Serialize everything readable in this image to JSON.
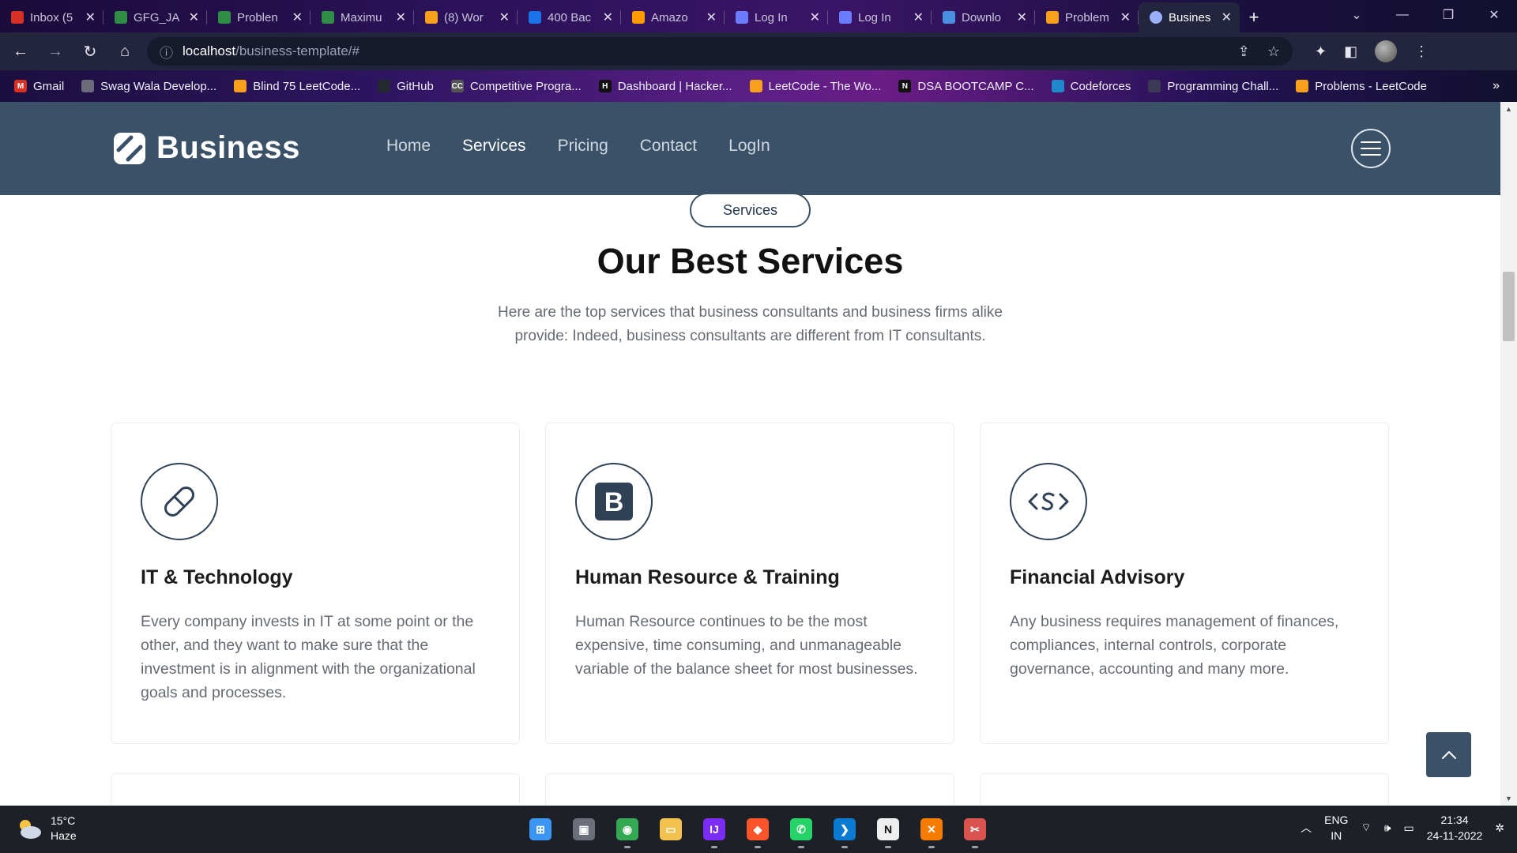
{
  "browser": {
    "tabs": [
      {
        "title": "Inbox (5",
        "color": "#d93025"
      },
      {
        "title": "GFG_JA",
        "color": "#2f8d46"
      },
      {
        "title": "Problen",
        "color": "#2f8d46"
      },
      {
        "title": "Maximu",
        "color": "#2f8d46"
      },
      {
        "title": "(8) Wor",
        "color": "#f89f1b"
      },
      {
        "title": "400 Bac",
        "color": "#1a73e8"
      },
      {
        "title": "Amazo",
        "color": "#ff9900"
      },
      {
        "title": "Log In",
        "color": "#6b7cff"
      },
      {
        "title": "Log In",
        "color": "#6b7cff"
      },
      {
        "title": "Downlo",
        "color": "#4a90e2"
      },
      {
        "title": "Problem",
        "color": "#f89f1b"
      }
    ],
    "active_tab": {
      "title": "Busines",
      "color": "#9ab0ff"
    },
    "new_tab_label": "+",
    "url_host": "localhost",
    "url_path": "/business-template/#",
    "bookmarks": [
      {
        "label": "Gmail",
        "color": "#d93025",
        "glyph": "M"
      },
      {
        "label": "Swag Wala Develop...",
        "color": "#6b6b7b",
        "glyph": ""
      },
      {
        "label": "Blind 75 LeetCode...",
        "color": "#f89f1b",
        "glyph": ""
      },
      {
        "label": "GitHub",
        "color": "#24292e",
        "glyph": ""
      },
      {
        "label": "Competitive Progra...",
        "color": "#555555",
        "glyph": "CC"
      },
      {
        "label": "Dashboard | Hacker...",
        "color": "#111111",
        "glyph": "H"
      },
      {
        "label": "LeetCode - The Wo...",
        "color": "#f89f1b",
        "glyph": ""
      },
      {
        "label": "DSA BOOTCAMP C...",
        "color": "#111111",
        "glyph": "N"
      },
      {
        "label": "Codeforces",
        "color": "#1f8acb",
        "glyph": ""
      },
      {
        "label": "Programming Chall...",
        "color": "#3a3a55",
        "glyph": ""
      },
      {
        "label": "Problems - LeetCode",
        "color": "#f89f1b",
        "glyph": ""
      }
    ],
    "bookmarks_more": "»"
  },
  "site": {
    "brand": "Business",
    "nav": [
      "Home",
      "Services",
      "Pricing",
      "Contact",
      "LogIn"
    ],
    "active_nav": "Services"
  },
  "services": {
    "pill": "Services",
    "title": "Our Best Services",
    "description": "Here are the top services that business consultants and business firms alike provide: Indeed, business consultants are different from IT consultants.",
    "cards": [
      {
        "icon": "capsule-icon",
        "title": "IT & Technology",
        "text": "Every company invests in IT at some point or the other, and they want to make sure that the investment is in alignment with the organizational goals and processes."
      },
      {
        "icon": "bootstrap-icon",
        "title": "Human Resource & Training",
        "text": "Human Resource continues to be the most expensive, time consuming, and unmanageable variable of the balance sheet for most businesses."
      },
      {
        "icon": "code-icon",
        "title": "Financial Advisory",
        "text": "Any business requires management of finances, compliances, internal controls, corporate governance, accounting and many more."
      }
    ]
  },
  "taskbar": {
    "weather_temp": "15°C",
    "weather_desc": "Haze",
    "lang_top": "ENG",
    "lang_bottom": "IN",
    "time": "21:34",
    "date": "24-11-2022",
    "apps": [
      {
        "name": "windows-start-icon",
        "color": "#3a96f0",
        "glyph": "⊞"
      },
      {
        "name": "task-view-icon",
        "color": "#6a6f7a",
        "glyph": "▣"
      },
      {
        "name": "chrome-icon",
        "color": "#34a853",
        "glyph": "◉"
      },
      {
        "name": "file-explorer-icon",
        "color": "#f2c14e",
        "glyph": "▭"
      },
      {
        "name": "intellij-icon",
        "color": "#7b2cf5",
        "glyph": "IJ"
      },
      {
        "name": "brave-icon",
        "color": "#fb542b",
        "glyph": "◆"
      },
      {
        "name": "whatsapp-icon",
        "color": "#25d366",
        "glyph": "✆"
      },
      {
        "name": "vscode-icon",
        "color": "#0a7bd1",
        "glyph": "❯"
      },
      {
        "name": "notion-icon",
        "color": "#eeeeee",
        "glyph": "N"
      },
      {
        "name": "xampp-icon",
        "color": "#f57c00",
        "glyph": "✕"
      },
      {
        "name": "snipping-tool-icon",
        "color": "#d9534f",
        "glyph": "✂"
      }
    ]
  },
  "colors": {
    "header_bg": "#3b5167",
    "accent": "#2e4155"
  }
}
